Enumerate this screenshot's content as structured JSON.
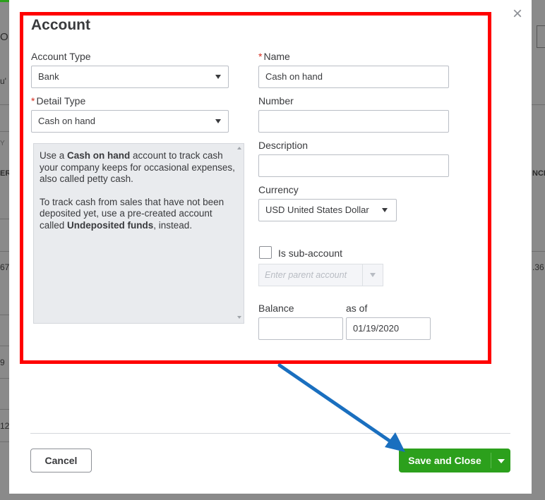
{
  "background": {
    "fragments": [
      "O",
      "u'",
      "Y",
      "ER",
      "NCE",
      "67",
      ".36",
      "9",
      "12"
    ]
  },
  "dialog": {
    "title": "Account",
    "close_glyph": "×",
    "account_type": {
      "label": "Account Type",
      "value": "Bank"
    },
    "detail_type": {
      "label": "Detail Type",
      "required_mark": "*",
      "value": "Cash on hand"
    },
    "description_panel": {
      "p1_prefix": "Use a ",
      "p1_bold": "Cash on hand",
      "p1_suffix": " account to track cash your company keeps for occasional expenses, also called petty cash.",
      "p2_prefix": "To track cash from sales that have not been deposited yet, use a pre-created account called ",
      "p2_bold": "Undeposited funds",
      "p2_suffix": ", instead."
    },
    "name": {
      "label": "Name",
      "required_mark": "*",
      "value": "Cash on hand"
    },
    "number": {
      "label": "Number",
      "value": ""
    },
    "description": {
      "label": "Description",
      "value": ""
    },
    "currency": {
      "label": "Currency",
      "value": "USD United States Dollar"
    },
    "sub_account": {
      "label": "Is sub-account",
      "checked": false
    },
    "parent_account": {
      "placeholder": "Enter parent account"
    },
    "balance": {
      "label": "Balance",
      "value": ""
    },
    "as_of": {
      "label": "as of",
      "value": "01/19/2020"
    },
    "buttons": {
      "cancel": "Cancel",
      "save_and_close": "Save and Close"
    }
  },
  "colors": {
    "highlight_box": "#ff0000",
    "annotation_arrow": "#1a6fbf",
    "primary_button": "#2ca01c",
    "required": "#d52b1e"
  }
}
